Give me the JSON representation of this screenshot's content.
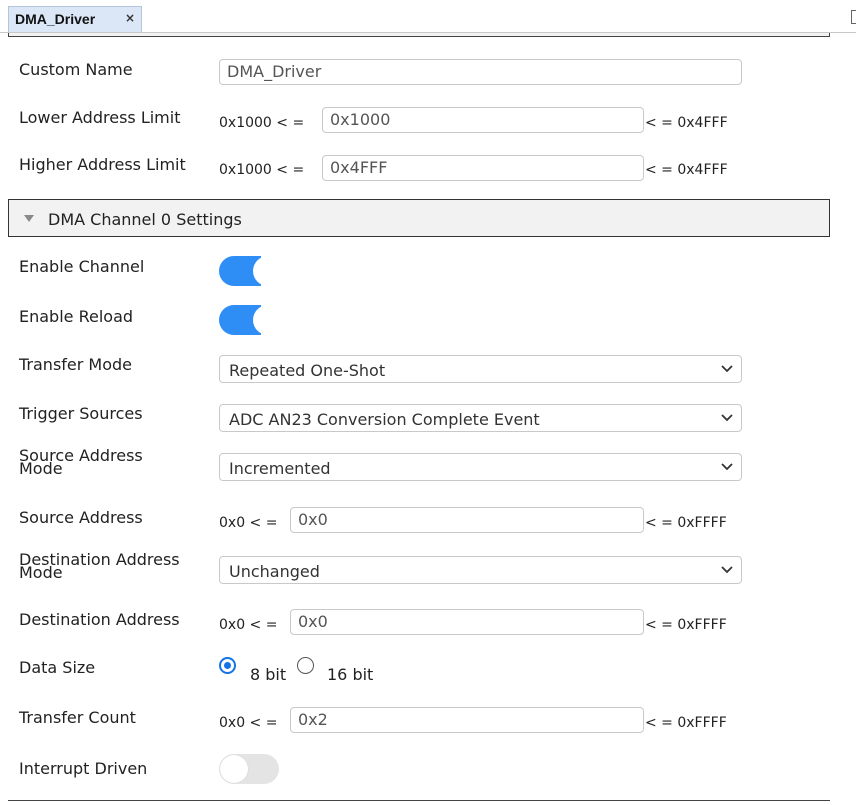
{
  "tab": {
    "label": "DMA_Driver",
    "close": "×"
  },
  "general": {
    "custom_name": {
      "label": "Custom Name",
      "value": "DMA_Driver"
    },
    "lower_limit": {
      "label": "Lower Address Limit",
      "min": "0x1000 < =",
      "value": "0x1000",
      "max": "< = 0x4FFF"
    },
    "higher_limit": {
      "label": "Higher Address Limit",
      "min": "0x1000 < =",
      "value": "0x4FFF",
      "max": "< = 0x4FFF"
    }
  },
  "section": {
    "title": "DMA Channel 0 Settings"
  },
  "channel": {
    "enable_channel": {
      "label": "Enable Channel",
      "on": true
    },
    "enable_reload": {
      "label": "Enable Reload",
      "on": true
    },
    "transfer_mode": {
      "label": "Transfer Mode",
      "value": "Repeated One-Shot"
    },
    "trigger_sources": {
      "label": "Trigger Sources",
      "value": "ADC AN23 Conversion Complete Event"
    },
    "source_address_mode": {
      "label_line1": "Source Address",
      "label_line2": "Mode",
      "value": "Incremented"
    },
    "source_address": {
      "label": "Source Address",
      "min": "0x0 < =",
      "value": "0x0",
      "max": "< = 0xFFFF"
    },
    "destination_address_mode": {
      "label_line1": "Destination Address",
      "label_line2": "Mode",
      "value": "Unchanged"
    },
    "destination_address": {
      "label": "Destination Address",
      "min": "0x0 < =",
      "value": "0x0",
      "max": "< = 0xFFFF"
    },
    "data_size": {
      "label": "Data Size",
      "options": [
        "8 bit",
        "16 bit"
      ],
      "selected": "8 bit"
    },
    "transfer_count": {
      "label": "Transfer Count",
      "min": "0x0 < =",
      "value": "0x2",
      "max": "< = 0xFFFF"
    },
    "interrupt_driven": {
      "label": "Interrupt Driven",
      "on": false
    }
  },
  "colors": {
    "toggle_on": "#2f8ef5",
    "radio_checked": "#1473e6",
    "tab_bg": "#dbe7f7"
  }
}
